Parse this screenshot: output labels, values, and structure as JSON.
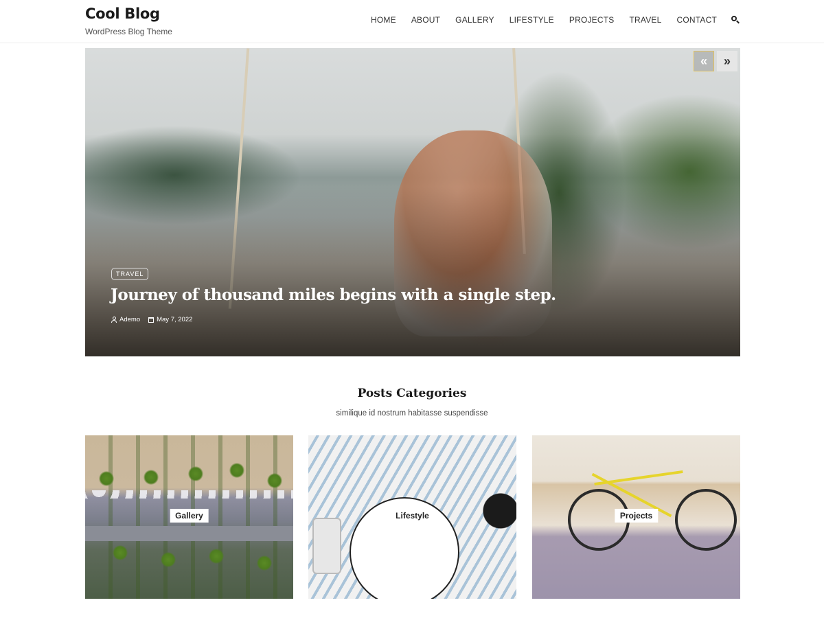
{
  "site": {
    "title": "Cool Blog",
    "tagline": "WordPress Blog Theme"
  },
  "nav": {
    "items": [
      {
        "label": "HOME"
      },
      {
        "label": "ABOUT"
      },
      {
        "label": "GALLERY"
      },
      {
        "label": "LIFESTYLE"
      },
      {
        "label": "PROJECTS"
      },
      {
        "label": "TRAVEL"
      },
      {
        "label": "CONTACT"
      }
    ],
    "search_icon": "search-icon"
  },
  "hero": {
    "category": "TRAVEL",
    "title": "Journey of thousand miles begins with a single step.",
    "author": "Ademo",
    "date": "May 7, 2022",
    "prev_label": "«",
    "next_label": "»",
    "author_icon": "user-icon",
    "date_icon": "calendar-icon"
  },
  "categories": {
    "title": "Posts Categories",
    "subtitle": "similique id nostrum habitasse suspendisse",
    "items": [
      {
        "label": "Gallery"
      },
      {
        "label": "Lifestyle"
      },
      {
        "label": "Projects"
      }
    ]
  },
  "colors": {
    "accent_border": "#e0c060",
    "text_dark": "#1a1a1a"
  }
}
